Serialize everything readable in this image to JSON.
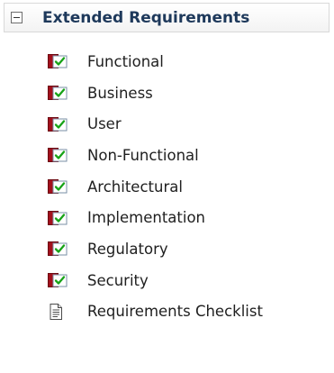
{
  "section": {
    "title": "Extended Requirements",
    "toggle_icon": "minus-collapse-icon"
  },
  "items": [
    {
      "label": "Functional",
      "icon": "requirement-checkbox-icon"
    },
    {
      "label": "Business",
      "icon": "requirement-checkbox-icon"
    },
    {
      "label": "User",
      "icon": "requirement-checkbox-icon"
    },
    {
      "label": "Non-Functional",
      "icon": "requirement-checkbox-icon"
    },
    {
      "label": "Architectural",
      "icon": "requirement-checkbox-icon"
    },
    {
      "label": "Implementation",
      "icon": "requirement-checkbox-icon"
    },
    {
      "label": "Regulatory",
      "icon": "requirement-checkbox-icon"
    },
    {
      "label": "Security",
      "icon": "requirement-checkbox-icon"
    },
    {
      "label": "Requirements Checklist",
      "icon": "document-icon"
    }
  ],
  "colors": {
    "header_text": "#1e395b",
    "icon_red": "#a3101c",
    "icon_green": "#17a317"
  }
}
